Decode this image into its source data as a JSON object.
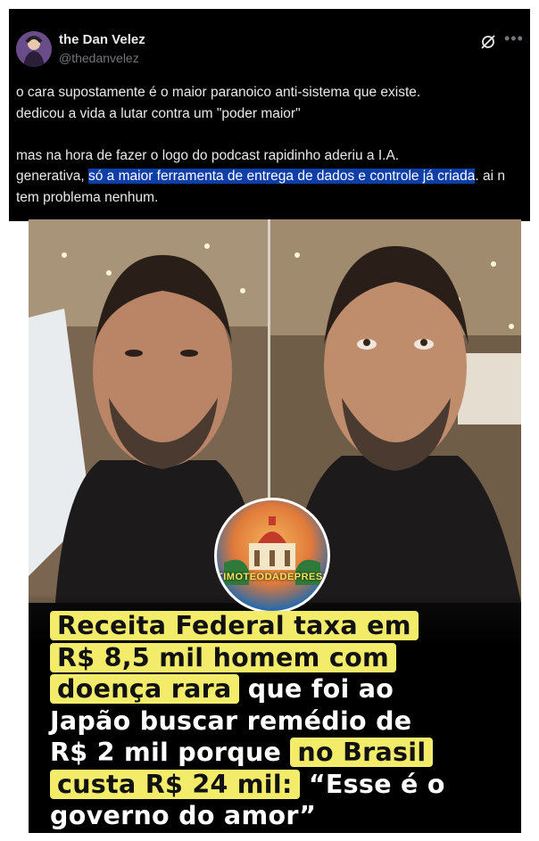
{
  "post": {
    "author_name": "the Dan Velez",
    "author_handle": "@thedanvelez",
    "text_before": "o cara supostamente é o maior paranoico anti-sistema que existe.\ndedicou a vida a lutar contra um \"poder maior\"\n\nmas na hora de fazer o logo do podcast rapidinho aderiu a I.A.\ngenerativa, ",
    "text_highlight": "só a maior ferramenta de entrega de dados e controle já criada",
    "text_after": ". ai n tem problema nenhum.",
    "icons": [
      "avatar",
      "grok-icon",
      "more-icon"
    ]
  },
  "image": {
    "badge_text": "TIMOTEODADEPRESSAO",
    "headline": [
      [
        {
          "t": "Receita Federal taxa em",
          "hl": true
        }
      ],
      [
        {
          "t": "R$ 8,5 mil homem com",
          "hl": true
        }
      ],
      [
        {
          "t": "doença rara",
          "hl": true
        },
        {
          "t": " que foi ao",
          "hl": false
        }
      ],
      [
        {
          "t": "Japão buscar remédio de",
          "hl": false
        }
      ],
      [
        {
          "t": "R$ 2 mil porque ",
          "hl": false
        },
        {
          "t": "no Brasil",
          "hl": true
        }
      ],
      [
        {
          "t": "custa R$ 24 mil:",
          "hl": true
        },
        {
          "t": " “Esse é o",
          "hl": false
        }
      ],
      [
        {
          "t": "governo do amor”",
          "hl": false
        }
      ]
    ],
    "highlight_color": "#f2ec6a"
  }
}
